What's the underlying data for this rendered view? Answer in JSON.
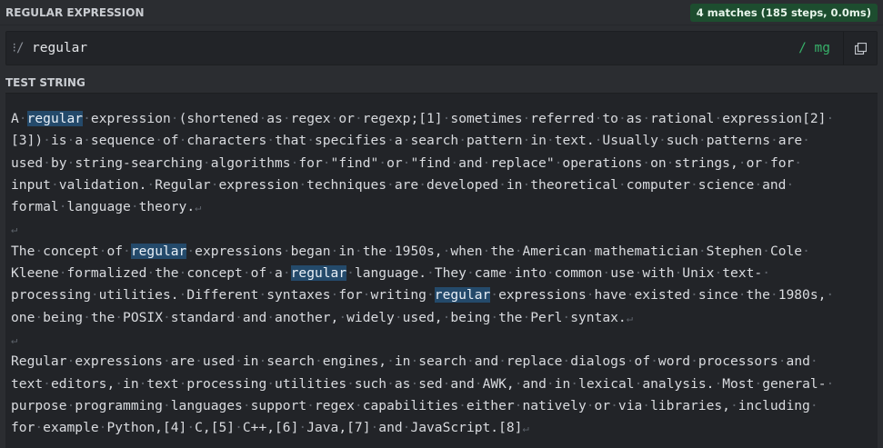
{
  "regex_section": {
    "title": "REGULAR EXPRESSION",
    "match_info": "4 matches (185 steps, 0.0ms)",
    "delimiter": "/",
    "pattern": "regular",
    "flags": "mg",
    "flag_delimiter": "/"
  },
  "test_section": {
    "title": "TEST STRING",
    "paragraphs": [
      [
        "A regular expression (shortened as regex or regexp;[1] sometimes referred to as rational expression[2]",
        "[3]) is a sequence of characters that specifies a search pattern in text. Usually such patterns are",
        "used by string-searching algorithms for \"find\" or \"find and replace\" operations on strings, or for",
        "input validation. Regular expression techniques are developed in theoretical computer science and",
        "formal language theory."
      ],
      [
        "The concept of regular expressions began in the 1950s, when the American mathematician Stephen Cole",
        "Kleene formalized the concept of a regular language. They came into common use with Unix text-",
        "processing utilities. Different syntaxes for writing regular expressions have existed since the 1980s,",
        "one being the POSIX standard and another, widely used, being the Perl syntax."
      ],
      [
        "Regular expressions are used in search engines, in search and replace dialogs of word processors and",
        "text editors, in text processing utilities such as sed and AWK, and in lexical analysis. Most general-",
        "purpose programming languages support regex capabilities either natively or via libraries, including",
        "for example Python,[4] C,[5] C++,[6] Java,[7] and JavaScript.[8]"
      ]
    ]
  },
  "colors": {
    "background": "#2b2d31",
    "editor": "#222428",
    "match_highlight": "#244a6b",
    "badge": "#1d4d2f",
    "flags": "#37b069"
  },
  "icons": {
    "delimiter": "drag-handle-icon",
    "copy": "copy-icon",
    "whitespace": "middle-dot",
    "line_end": "return-arrow"
  }
}
